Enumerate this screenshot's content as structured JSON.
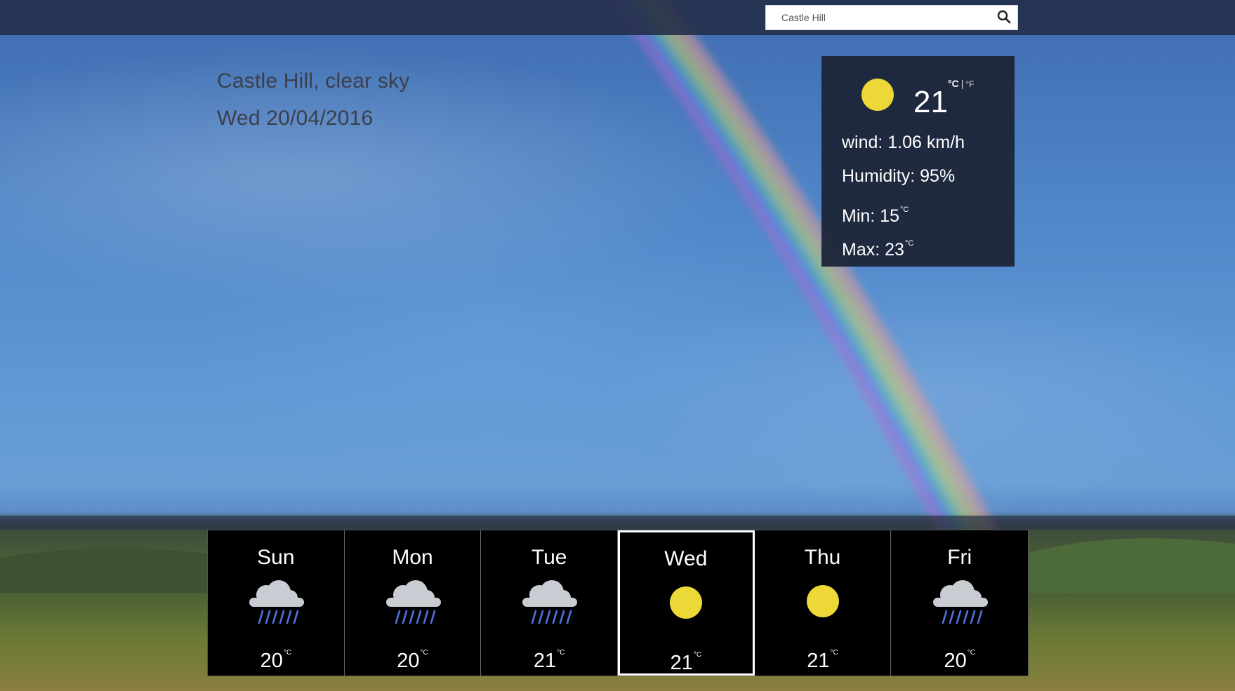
{
  "search": {
    "value": "Castle Hill",
    "placeholder": ""
  },
  "header": {
    "location_line": "Castle Hill, clear sky",
    "date_line": "Wed 20/04/2016"
  },
  "current": {
    "icon": "sun-icon",
    "temperature": "21",
    "unit_c": "°C",
    "unit_sep": "|",
    "unit_f": "°F",
    "wind": "wind: 1.06 km/h",
    "humidity": "Humidity: 95%",
    "min": "Min: 15",
    "max": "Max: 23",
    "degree_mark": "°C"
  },
  "forecast": [
    {
      "day": "Sun",
      "icon": "rain-cloud-icon",
      "temp": "20",
      "unit": "°C"
    },
    {
      "day": "Mon",
      "icon": "rain-cloud-icon",
      "temp": "20",
      "unit": "°C"
    },
    {
      "day": "Tue",
      "icon": "rain-cloud-icon",
      "temp": "21",
      "unit": "°C"
    },
    {
      "day": "Wed",
      "icon": "sun-icon",
      "temp": "21",
      "unit": "°C",
      "selected": true
    },
    {
      "day": "Thu",
      "icon": "sun-icon",
      "temp": "21",
      "unit": "°C"
    },
    {
      "day": "Fri",
      "icon": "rain-cloud-icon",
      "temp": "20",
      "unit": "°C"
    }
  ],
  "colors": {
    "sun": "#ecd836",
    "cloud": "#c9ccd3",
    "rain": "#4f72e0",
    "panel": "#1c2538",
    "topbar": "#222c46"
  }
}
